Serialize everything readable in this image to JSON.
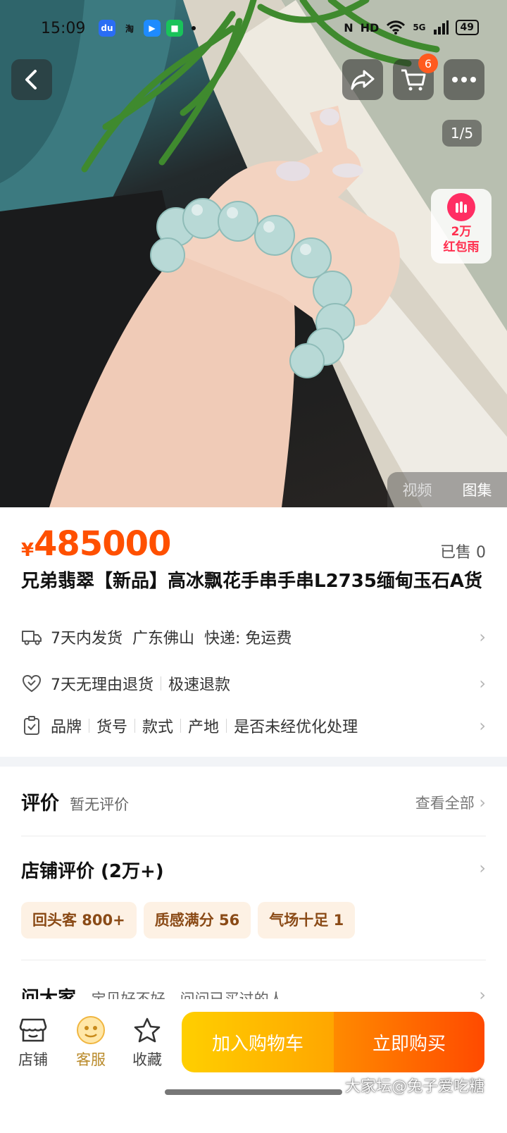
{
  "status_bar": {
    "time": "15:09",
    "apps": [
      {
        "icon": "baidu-app-icon",
        "glyph": "du",
        "color": "#2a6df4"
      },
      {
        "icon": "taobao-app-icon",
        "glyph": "淘",
        "color": "#ff6a00"
      },
      {
        "icon": "video-app-icon",
        "glyph": "▶",
        "color": "#1e8bff"
      },
      {
        "icon": "messages-app-icon",
        "glyph": "■",
        "color": "#19c35a"
      }
    ],
    "nfc": "N",
    "hd": "HD",
    "network": "5G",
    "battery": "49"
  },
  "header": {
    "back_icon": "back-arrow-icon",
    "share_icon": "share-icon",
    "cart_icon": "cart-icon",
    "cart_count": "6",
    "more_icon": "more-dots-icon"
  },
  "gallery": {
    "page_counter": "1/5",
    "red_packet": {
      "line1": "2万",
      "line2": "红包雨"
    },
    "tabs": [
      "视频",
      "图集"
    ]
  },
  "product": {
    "currency": "¥",
    "price": "485000",
    "sold": "已售 0",
    "title": "兄弟翡翠【新品】高冰飘花手串手串L2735缅甸玉石A货"
  },
  "services": {
    "shipping": {
      "time": "7天内发货",
      "origin": "广东佛山",
      "express": "快递: 免运费"
    },
    "returns": {
      "policy": "7天无理由退货",
      "refund": "极速退款"
    },
    "params": [
      "品牌",
      "货号",
      "款式",
      "产地",
      "是否未经优化处理"
    ]
  },
  "reviews": {
    "title": "评价",
    "subtitle": "暂无评价",
    "view_all": "查看全部"
  },
  "shop_reviews": {
    "title": "店铺评价 (2万+)",
    "tags": [
      "回头客 800+",
      "质感满分 56",
      "气场十足 1"
    ]
  },
  "ask": {
    "title": "问大家",
    "subtitle": "宝贝好不好，问问已买过的人"
  },
  "bottom_nav": {
    "shop": "店铺",
    "service": "客服",
    "favorite": "收藏",
    "add_to_cart": "加入购物车",
    "buy_now": "立即购买"
  },
  "watermark": "大家坛@兔子爱吃糖",
  "colors": {
    "price": "#ff5000",
    "cart_button": "#ffb800",
    "buy_button": "#ff6a00",
    "tag_bg": "#fdf1e4"
  }
}
